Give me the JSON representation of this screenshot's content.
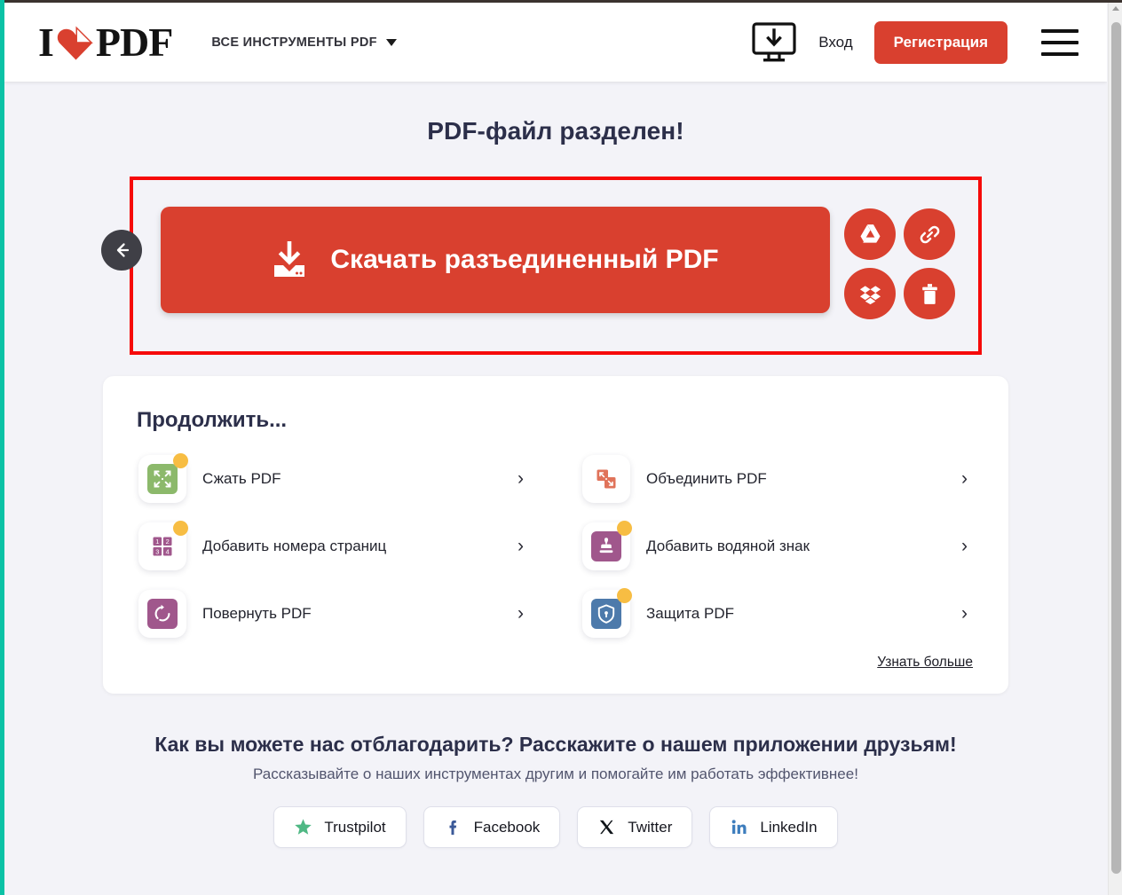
{
  "header": {
    "logo_i": "I",
    "logo_pdf": "PDF",
    "logo_heart_icon": "heart-icon",
    "all_tools_label": "ВСЕ ИНСТРУМЕНТЫ PDF",
    "desktop_icon": "desktop-download-icon",
    "login_label": "Вход",
    "signup_label": "Регистрация",
    "menu_icon": "hamburger-menu-icon"
  },
  "main": {
    "title": "PDF-файл разделен!",
    "download_label": "Скачать разъединенный PDF",
    "download_icon": "download-icon",
    "back_icon": "arrow-left-icon",
    "cloud_actions": [
      {
        "name": "google-drive",
        "icon": "google-drive-icon"
      },
      {
        "name": "copy-link",
        "icon": "link-icon"
      },
      {
        "name": "dropbox",
        "icon": "dropbox-icon"
      },
      {
        "name": "delete",
        "icon": "trash-icon"
      }
    ]
  },
  "continue": {
    "title": "Продолжить...",
    "learn_more_label": "Узнать больше",
    "chevron": "›",
    "tools": [
      {
        "label": "Сжать PDF",
        "icon": "compress-icon",
        "color": "#8cb96b",
        "badge": true
      },
      {
        "label": "Объединить PDF",
        "icon": "merge-icon",
        "color": "#e0735a",
        "badge": false
      },
      {
        "label": "Добавить номера страниц",
        "icon": "page-numbers-icon",
        "color": "#a0578c",
        "badge": true
      },
      {
        "label": "Добавить водяной знак",
        "icon": "watermark-icon",
        "color": "#a0578c",
        "badge": true
      },
      {
        "label": "Повернуть PDF",
        "icon": "rotate-icon",
        "color": "#a0578c",
        "badge": false
      },
      {
        "label": "Защита PDF",
        "icon": "shield-lock-icon",
        "color": "#4d7aab",
        "badge": true
      }
    ]
  },
  "share": {
    "title": "Как вы можете нас отблагодарить? Расскажите о нашем приложении друзьям!",
    "subtitle": "Рассказывайте о наших инструментах другим и помогайте им работать эффективнее!",
    "buttons": [
      {
        "label": "Trustpilot",
        "icon": "trustpilot-star-icon",
        "color": "#4fb884"
      },
      {
        "label": "Facebook",
        "icon": "facebook-icon",
        "color": "#3b5998"
      },
      {
        "label": "Twitter",
        "icon": "twitter-x-icon",
        "color": "#0f1419"
      },
      {
        "label": "LinkedIn",
        "icon": "linkedin-icon",
        "color": "#3d7dbd"
      }
    ]
  },
  "colors": {
    "brand_red": "#d9402f",
    "highlight_red": "#f60a0a",
    "page_bg": "#f3f3f8",
    "title_navy": "#2c2f4a",
    "badge_yellow": "#f7bd43",
    "left_edge_teal": "#0bc2a6"
  }
}
